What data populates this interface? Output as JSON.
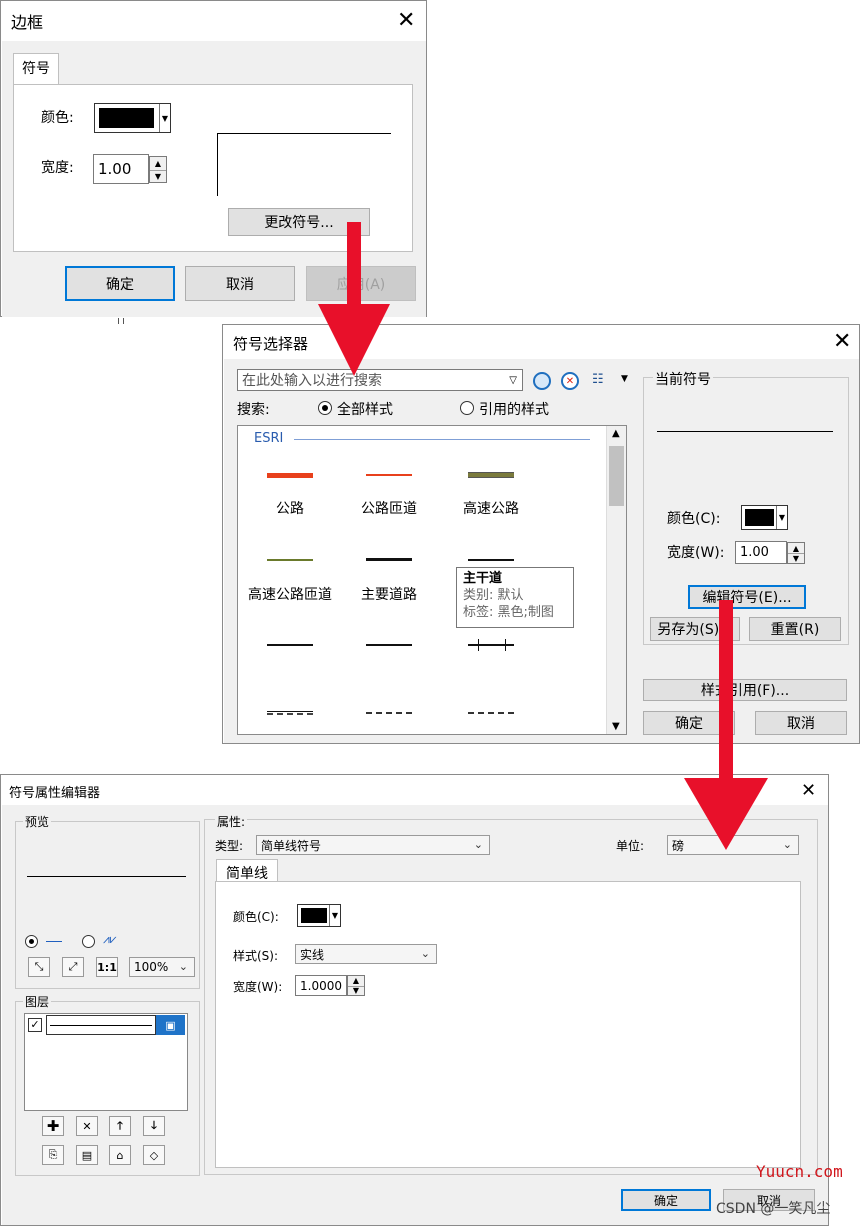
{
  "border_dialog": {
    "title": "边框",
    "tab": "符号",
    "color_label": "颜色:",
    "width_label": "宽度:",
    "width_value": "1.00",
    "change_symbol": "更改符号...",
    "ok": "确定",
    "cancel": "取消",
    "apply": "应用(A)"
  },
  "selector_dialog": {
    "title": "符号选择器",
    "search_placeholder": "在此处输入以进行搜索",
    "search_label": "搜索:",
    "radio_all": "全部样式",
    "radio_ref": "引用的样式",
    "group_name": "ESRI",
    "symbols": [
      "公路",
      "公路匝道",
      "高速公路",
      "高速公路匝道",
      "主要道路"
    ],
    "tooltip": {
      "name": "主干道",
      "category": "类别: 默认",
      "tags": "标签: 黑色;制图"
    },
    "current_symbol": "当前符号",
    "color_label": "颜色(C):",
    "width_label": "宽度(W):",
    "width_value": "1.00",
    "edit_symbol": "编辑符号(E)...",
    "save_as": "另存为(S)...",
    "reset": "重置(R)",
    "style_refs": "样式引用(F)...",
    "ok": "确定",
    "cancel": "取消"
  },
  "editor_dialog": {
    "title": "符号属性编辑器",
    "preview": "预览",
    "zoom": "100%",
    "layers": "图层",
    "properties": "属性:",
    "type_label": "类型:",
    "type_value": "简单线符号",
    "unit_label": "单位:",
    "unit_value": "磅",
    "tab": "简单线",
    "color_label": "颜色(C):",
    "style_label": "样式(S):",
    "style_value": "实线",
    "width_label": "宽度(W):",
    "width_value": "1.0000",
    "ok": "确定",
    "cancel": "取消"
  },
  "watermark": {
    "site": "Yuucn.com",
    "author": "CSDN @一笑凡尘"
  },
  "colors": {
    "arrow": "#e8102a",
    "accent": "#0078d7",
    "road_red": "#e8401c",
    "highway_olive": "#7a7a3c"
  }
}
